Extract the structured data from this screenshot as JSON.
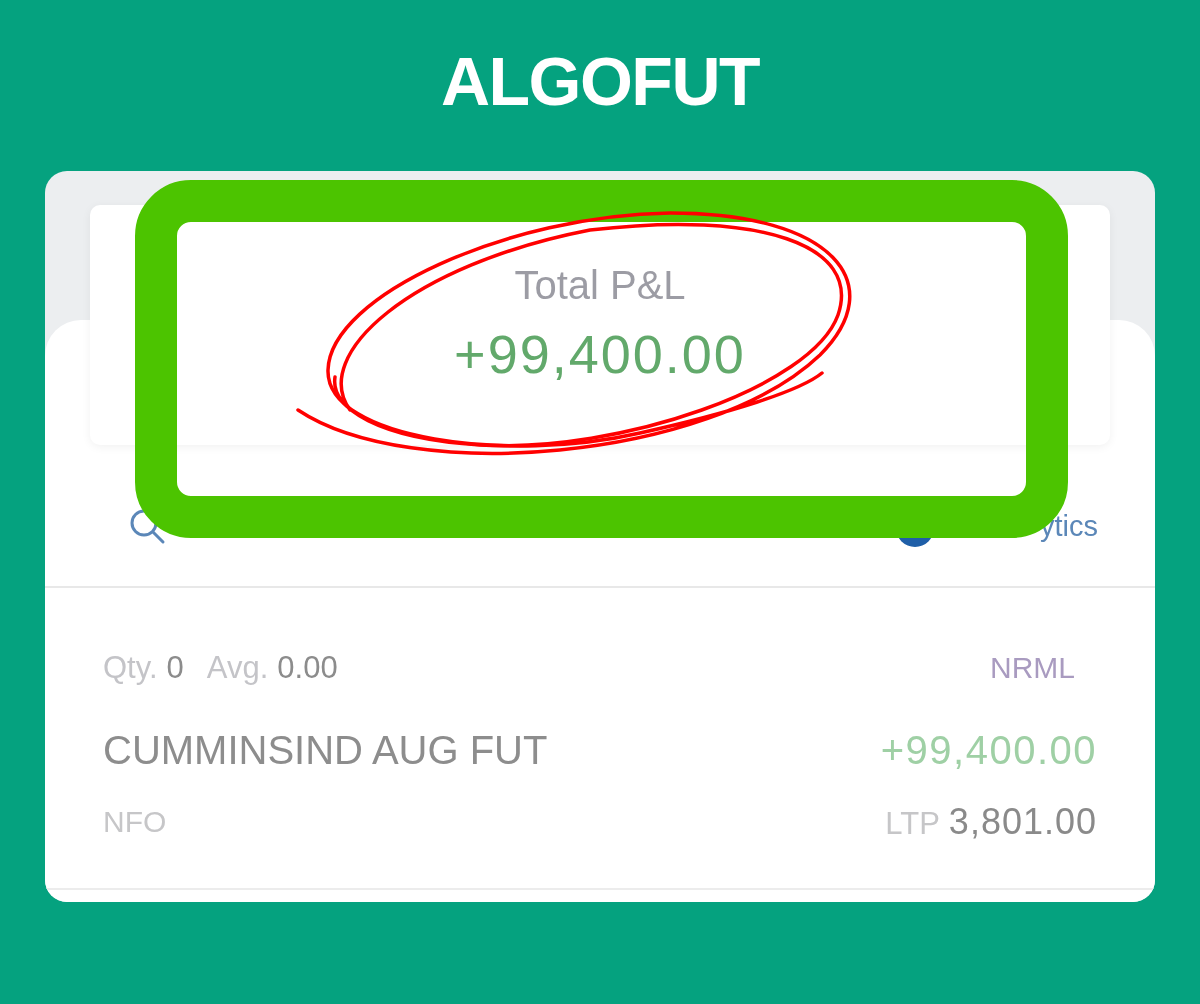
{
  "title": "ALGOFUT",
  "summary": {
    "label": "Total P&L",
    "value": "+99,400.00"
  },
  "toolbar": {
    "link": "ytics"
  },
  "positions": [
    {
      "qty_label": "Qty.",
      "qty": "0",
      "avg_label": "Avg.",
      "avg": "0.00",
      "product": "NRML",
      "symbol": "CUMMINSIND AUG FUT",
      "pnl": "+99,400.00",
      "exchange": "NFO",
      "ltp_label": "LTP",
      "ltp": "3,801.00"
    }
  ]
}
